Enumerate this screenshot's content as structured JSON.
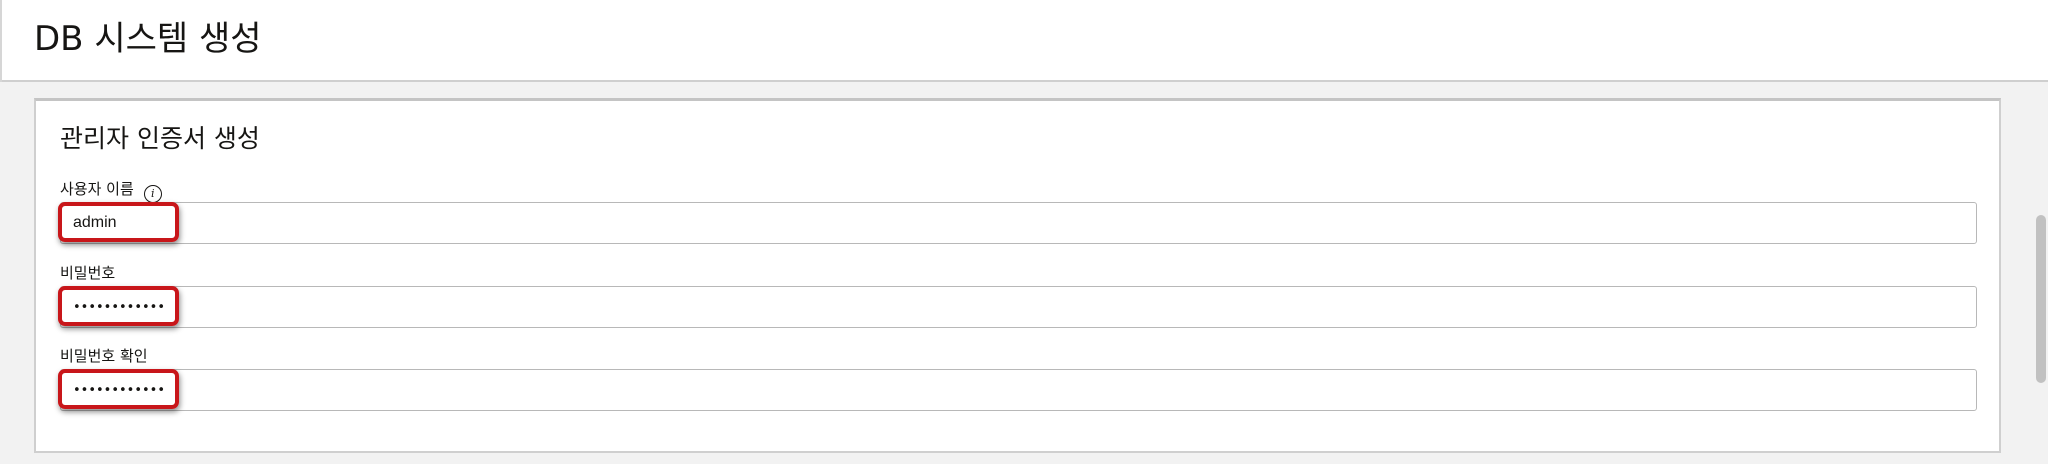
{
  "header": {
    "title": "DB 시스템 생성"
  },
  "section": {
    "title": "관리자 인증서 생성"
  },
  "fields": {
    "username": {
      "label": "사용자 이름",
      "value": "admin",
      "info_icon": "info-icon"
    },
    "password": {
      "label": "비밀번호",
      "value": "••••••••••••"
    },
    "confirm_password": {
      "label": "비밀번호 확인",
      "value": "••••••••••••"
    }
  },
  "colors": {
    "highlight": "#c8161a",
    "background": "#f2f2f2",
    "panel": "#ffffff",
    "border": "#b8b8b8"
  }
}
